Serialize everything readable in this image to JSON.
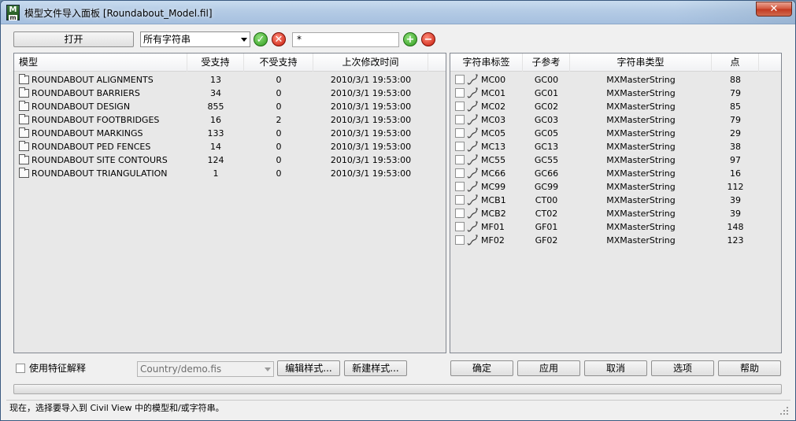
{
  "window": {
    "title": "模型文件导入面板 [Roundabout_Model.fil]",
    "close_glyph": "✕"
  },
  "toolbar": {
    "open_label": "打开",
    "filter_value": "所有字符串",
    "pattern_value": "*"
  },
  "models": {
    "columns": [
      "模型",
      "受支持",
      "不受支持",
      "上次修改时间"
    ],
    "rows": [
      {
        "name": "ROUNDABOUT ALIGNMENTS",
        "supported": "13",
        "unsupported": "0",
        "modified": "2010/3/1 19:53:00"
      },
      {
        "name": "ROUNDABOUT BARRIERS",
        "supported": "34",
        "unsupported": "0",
        "modified": "2010/3/1 19:53:00"
      },
      {
        "name": "ROUNDABOUT DESIGN",
        "supported": "855",
        "unsupported": "0",
        "modified": "2010/3/1 19:53:00"
      },
      {
        "name": "ROUNDABOUT FOOTBRIDGES",
        "supported": "16",
        "unsupported": "2",
        "modified": "2010/3/1 19:53:00"
      },
      {
        "name": "ROUNDABOUT MARKINGS",
        "supported": "133",
        "unsupported": "0",
        "modified": "2010/3/1 19:53:00"
      },
      {
        "name": "ROUNDABOUT PED FENCES",
        "supported": "14",
        "unsupported": "0",
        "modified": "2010/3/1 19:53:00"
      },
      {
        "name": "ROUNDABOUT SITE CONTOURS",
        "supported": "124",
        "unsupported": "0",
        "modified": "2010/3/1 19:53:00"
      },
      {
        "name": "ROUNDABOUT TRIANGULATION",
        "supported": "1",
        "unsupported": "0",
        "modified": "2010/3/1 19:53:00"
      }
    ]
  },
  "strings": {
    "columns": [
      "字符串标签",
      "子参考",
      "字符串类型",
      "点"
    ],
    "rows": [
      {
        "label": "MC00",
        "ref": "GC00",
        "type": "MXMasterString",
        "points": "88"
      },
      {
        "label": "MC01",
        "ref": "GC01",
        "type": "MXMasterString",
        "points": "79"
      },
      {
        "label": "MC02",
        "ref": "GC02",
        "type": "MXMasterString",
        "points": "85"
      },
      {
        "label": "MC03",
        "ref": "GC03",
        "type": "MXMasterString",
        "points": "79"
      },
      {
        "label": "MC05",
        "ref": "GC05",
        "type": "MXMasterString",
        "points": "29"
      },
      {
        "label": "MC13",
        "ref": "GC13",
        "type": "MXMasterString",
        "points": "38"
      },
      {
        "label": "MC55",
        "ref": "GC55",
        "type": "MXMasterString",
        "points": "97"
      },
      {
        "label": "MC66",
        "ref": "GC66",
        "type": "MXMasterString",
        "points": "16"
      },
      {
        "label": "MC99",
        "ref": "GC99",
        "type": "MXMasterString",
        "points": "112"
      },
      {
        "label": "MCB1",
        "ref": "CT00",
        "type": "MXMasterString",
        "points": "39"
      },
      {
        "label": "MCB2",
        "ref": "CT02",
        "type": "MXMasterString",
        "points": "39"
      },
      {
        "label": "MF01",
        "ref": "GF01",
        "type": "MXMasterString",
        "points": "148"
      },
      {
        "label": "MF02",
        "ref": "GF02",
        "type": "MXMasterString",
        "points": "123"
      }
    ]
  },
  "bottom": {
    "use_feature_label": "使用特征解释",
    "style_file": "Country/demo.fis",
    "edit_style_label": "编辑样式...",
    "new_style_label": "新建样式...",
    "ok_label": "确定",
    "apply_label": "应用",
    "cancel_label": "取消",
    "options_label": "选项",
    "help_label": "帮助"
  },
  "status": {
    "text": "现在，选择要导入到 Civil View 中的模型和/或字符串。"
  }
}
